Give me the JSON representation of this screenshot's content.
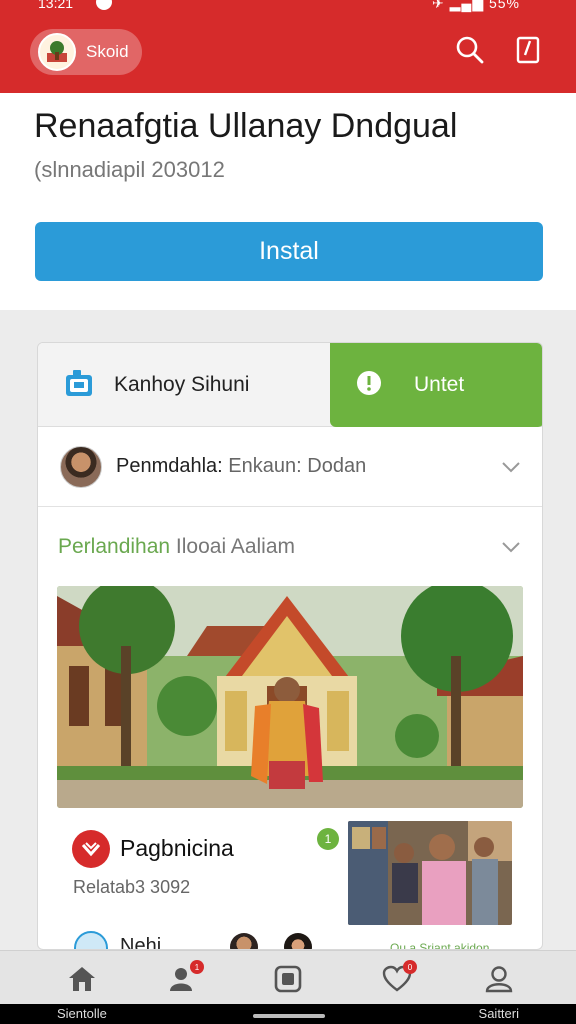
{
  "status_bar": {
    "time": "13:21",
    "right": "✈ ▂▄▆ 55%"
  },
  "app_bar": {
    "app_name": "Skoid"
  },
  "header": {
    "title": "Renaafgtia Ullanay Dndgual",
    "subtitle": "(slnnadiapil 203012",
    "install_label": "Instal"
  },
  "tabs": {
    "left_label": "Kanhoy Sihuni",
    "right_label": "Untet"
  },
  "row_person": {
    "name": "Penmdahla:",
    "detail": " Enkaun: Dodan"
  },
  "row_section": {
    "green": "Perlandihan",
    "rest": " Ilooai Aaliam"
  },
  "post": {
    "title": "Pagbnicina",
    "subtitle": "Relatab3 3092",
    "badge": "1",
    "small_label": "Nehi",
    "tiny_caption": "Qu a Srjant akidon"
  },
  "bottom_nav": {
    "items": [
      {
        "icon": "home-icon"
      },
      {
        "icon": "people-icon",
        "badge": "1"
      },
      {
        "icon": "square-app-icon"
      },
      {
        "icon": "heart-icon",
        "badge": "0"
      },
      {
        "icon": "profile-icon"
      }
    ]
  },
  "system_bar": {
    "left": "Sientolle",
    "right": "Saitteri"
  },
  "colors": {
    "brand_red": "#d62b2b",
    "install_blue": "#2b9bd8",
    "green": "#6db33f"
  }
}
